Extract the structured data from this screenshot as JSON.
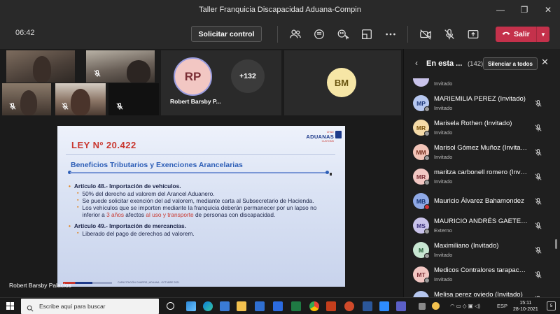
{
  "window": {
    "title": "Taller Franquicia Discapacidad Aduana-Compin",
    "controls": {
      "minimize": "—",
      "maximize": "❐",
      "close": "✕"
    }
  },
  "toolbar": {
    "timer": "06:42",
    "request_control": "Solicitar control",
    "leave_label": "Salir",
    "leave_chevron": "▼"
  },
  "stage": {
    "tiles": [
      {
        "id": "video-1",
        "icon": "mic-off-icon"
      },
      {
        "id": "video-2",
        "icon": "mic-off-icon"
      },
      {
        "id": "video-3",
        "icon": "mic-off-icon"
      },
      {
        "id": "video-4",
        "icon": "mic-off-icon"
      },
      {
        "id": "blank-tile",
        "icon": "mic-off-icon"
      }
    ],
    "rp_initials": "RP",
    "rp_name": "Robert Barsby P...",
    "more_count": "+132",
    "bm_initials": "BM",
    "presenter_name": "Robert Barsby Palacios"
  },
  "slide": {
    "ley": "LEY Nº 20.422",
    "logo_title": "ADUANAS",
    "logo_top": "CHILE",
    "logo_sub": "CUSTOMS",
    "heading": "Beneficios Tributarios y Exenciones Arancelarias",
    "art48_title": "Artículo 48.- Importación de vehículos.",
    "art48_b1": "50% del derecho ad valorem del Arancel Aduanero.",
    "art48_b2": "Se puede solicitar exención del ad valorem, mediante carta al Subsecretario de Hacienda.",
    "art48_b3_a": "Los vehículos que se importen mediante la franquicia deberán permanecer por un lapso no inferior a ",
    "art48_b3_h1": "3 años",
    "art48_b3_b": " afectos ",
    "art48_b3_h2": "al uso y transporte",
    "art48_b3_c": " de personas con discapacidad.",
    "art49_title": "Artículo 49.- Importación de mercancías.",
    "art49_b1": "Liberado del pago de derechos ad valorem.",
    "footer_text": "CAPACITACIÓN CHARPIS | ADUANA - OCTUBRE 2021"
  },
  "panel": {
    "back": "‹",
    "title": "En esta ...",
    "count": "(142)",
    "mute_all": "Silenciar a todos",
    "close": "✕",
    "partial_status": "Invitado",
    "participants": [
      {
        "initials": "MP",
        "name": "MARIEMILIA PEREZ (Invitado)",
        "status": "Invitado",
        "color": "#b6c7ef",
        "fg": "#1f3a7a",
        "presence": "gray"
      },
      {
        "initials": "MR",
        "name": "Marisela Rothen (Invitado)",
        "status": "Invitado",
        "color": "#f5dba8",
        "fg": "#7a5410",
        "presence": "gray"
      },
      {
        "initials": "MM",
        "name": "Marisol Gómez Muñoz (Invitado)",
        "status": "Invitado",
        "color": "#f2c4b8",
        "fg": "#7a3322",
        "presence": "gray"
      },
      {
        "initials": "MR",
        "name": "maritza carbonell romero (Invitado)",
        "status": "Invitado",
        "color": "#f2c7c3",
        "fg": "#7a2e35",
        "presence": "gray"
      },
      {
        "initials": "MB",
        "name": "Mauricio Álvarez Bahamondez",
        "status": "",
        "color": "#8fa9e6",
        "fg": "#13306e",
        "presence": "red"
      },
      {
        "initials": "MS",
        "name": "MAURICIO ANDRÉS GAETE S...",
        "status": "Externo",
        "color": "#c9c3ea",
        "fg": "#3a2f7a",
        "presence": "gray"
      },
      {
        "initials": "M",
        "name": "Maximiliano (Invitado)",
        "status": "Invitado",
        "color": "#c8e6d2",
        "fg": "#1f5a33",
        "presence": "gray"
      },
      {
        "initials": "MT",
        "name": "Medicos Contralores tarapaca...",
        "status": "Invitado",
        "color": "#f2c7c3",
        "fg": "#7a2e35",
        "presence": "gray"
      },
      {
        "initials": "",
        "name": "Melisa perez oviedo (Invitado)",
        "status": "",
        "color": "#b6c7ef",
        "fg": "#1f3a7a",
        "presence": "gray"
      }
    ]
  },
  "taskbar": {
    "search_placeholder": "Escribe aquí para buscar",
    "lang": "ESP",
    "time": "15:11",
    "date": "28-10-2021",
    "notifications": "5"
  }
}
